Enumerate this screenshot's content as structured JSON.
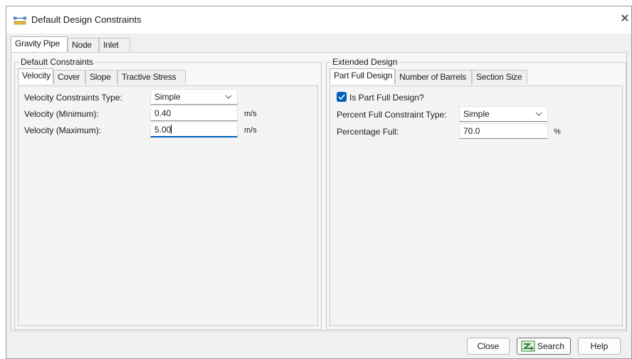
{
  "window": {
    "title": "Default Design Constraints",
    "title_icon": "ruler-dimension-icon",
    "close_glyph": "✕"
  },
  "tabs": [
    "Gravity Pipe",
    "Node",
    "Inlet"
  ],
  "default_constraints": {
    "title": "Default Constraints",
    "tabs": [
      "Velocity",
      "Cover",
      "Slope",
      "Tractive Stress"
    ],
    "velocity": {
      "type_label": "Velocity Constraints Type:",
      "type_value": "Simple",
      "min_label": "Velocity (Minimum):",
      "min_value": "0.40",
      "min_unit": "m/s",
      "max_label": "Velocity (Maximum):",
      "max_value": "5.00",
      "max_unit": "m/s"
    }
  },
  "extended_design": {
    "title": "Extended Design",
    "tabs": [
      "Part Full Design",
      "Number of Barrels",
      "Section Size"
    ],
    "part_full": {
      "checkbox_label": "Is Part Full Design?",
      "checkbox_checked": true,
      "type_label": "Percent Full Constraint Type:",
      "type_value": "Simple",
      "pct_label": "Percentage Full:",
      "pct_value": "70.0",
      "pct_unit": "%"
    }
  },
  "buttons": {
    "close": "Close",
    "search": "Search",
    "help": "Help"
  },
  "colors": {
    "accent": "#005fb8",
    "search_icon": "#2e7d32"
  }
}
